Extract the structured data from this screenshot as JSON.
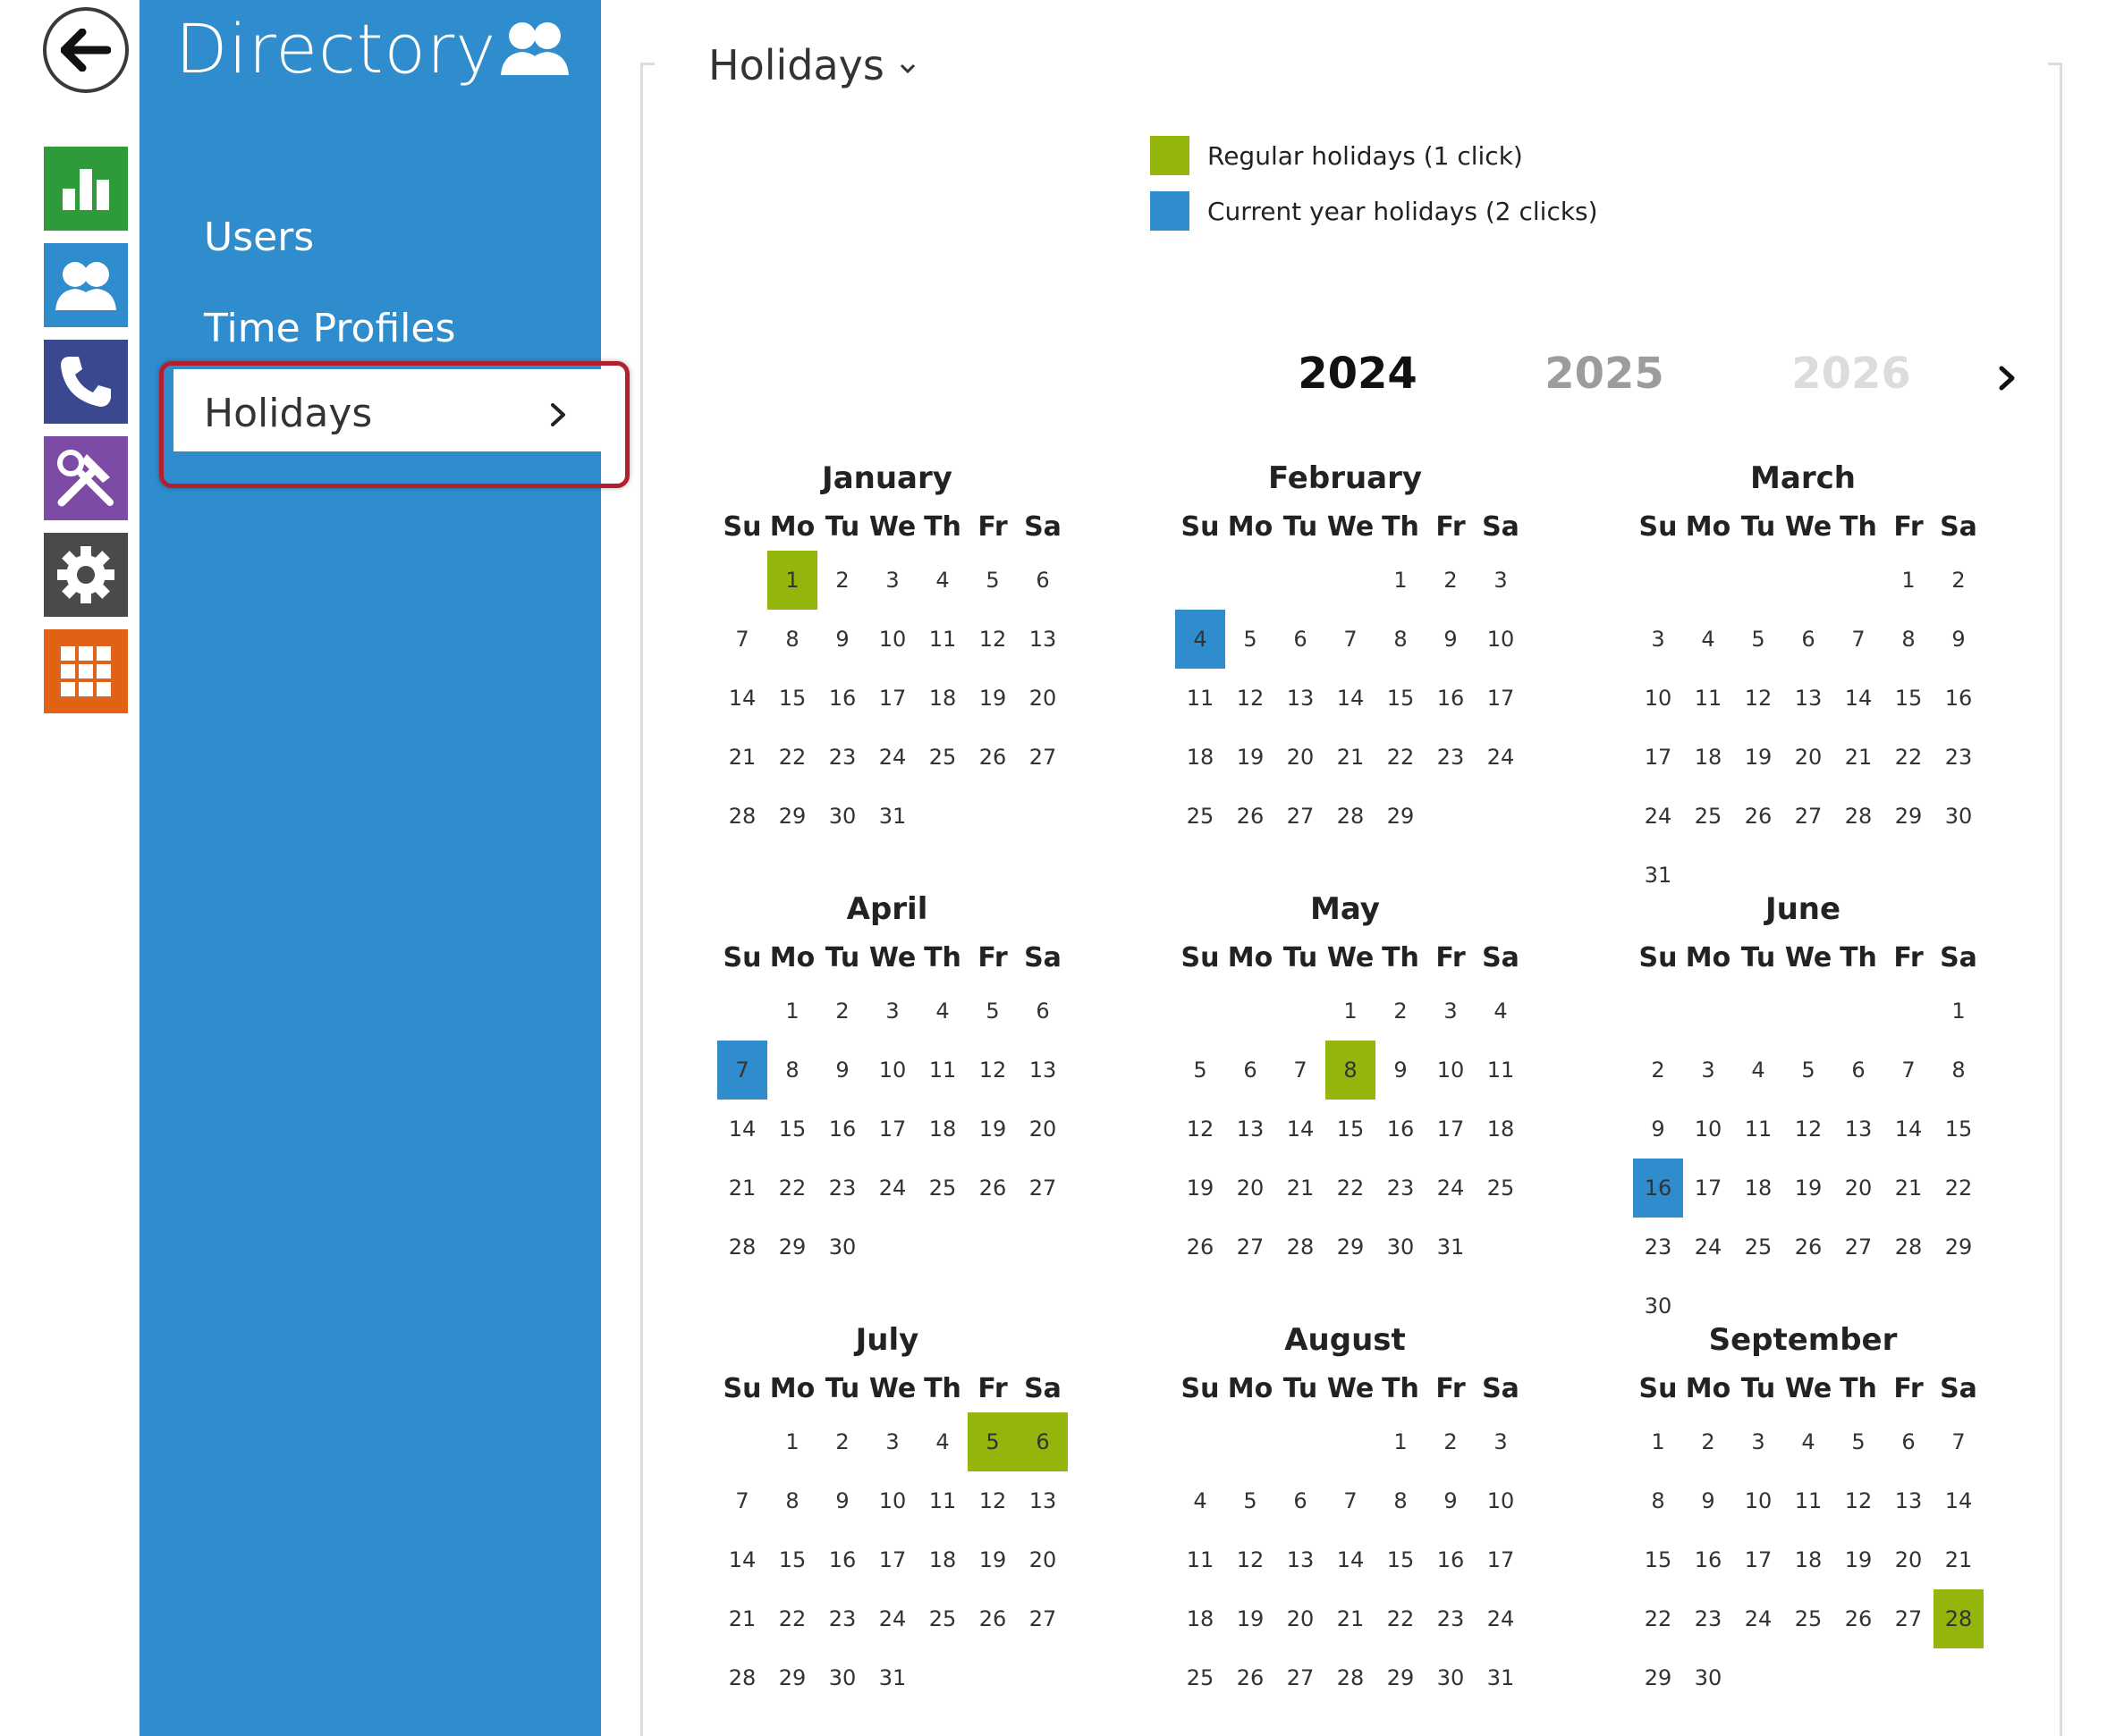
{
  "sidebar": {
    "title": "Directory",
    "items": [
      {
        "label": "Users"
      },
      {
        "label": "Time Profiles"
      },
      {
        "label": "Holidays"
      }
    ]
  },
  "rail": {
    "tiles": [
      {
        "name": "status-tile",
        "icon": "bar-chart-icon",
        "color": "#2e9a3a"
      },
      {
        "name": "directory-tile",
        "icon": "users-icon",
        "color": "#2f8ccd"
      },
      {
        "name": "calls-tile",
        "icon": "phone-icon",
        "color": "#3a4890"
      },
      {
        "name": "hardware-tile",
        "icon": "tools-icon",
        "color": "#7d4aa6"
      },
      {
        "name": "system-tile",
        "icon": "gear-icon",
        "color": "#4a4a4a"
      },
      {
        "name": "services-tile",
        "icon": "grid-icon",
        "color": "#e26215"
      }
    ]
  },
  "page": {
    "title": "Holidays"
  },
  "legend": [
    {
      "label": "Regular holidays (1 click)",
      "color": "#94b50b"
    },
    {
      "label": "Current year holidays (2 clicks)",
      "color": "#2f8ccd"
    }
  ],
  "years": [
    {
      "label": "2024",
      "color": "#111111"
    },
    {
      "label": "2025",
      "color": "#9c9c9c"
    },
    {
      "label": "2026",
      "color": "#dcdcdc"
    }
  ],
  "weekdays": [
    "Su",
    "Mo",
    "Tu",
    "We",
    "Th",
    "Fr",
    "Sa"
  ],
  "months": [
    {
      "name": "January",
      "start": 1,
      "days": 31,
      "regular": [
        1
      ],
      "current": []
    },
    {
      "name": "February",
      "start": 4,
      "days": 29,
      "regular": [],
      "current": [
        4
      ]
    },
    {
      "name": "March",
      "start": 5,
      "days": 31,
      "regular": [],
      "current": []
    },
    {
      "name": "April",
      "start": 1,
      "days": 30,
      "regular": [],
      "current": [
        7
      ]
    },
    {
      "name": "May",
      "start": 3,
      "days": 31,
      "regular": [
        8
      ],
      "current": []
    },
    {
      "name": "June",
      "start": 6,
      "days": 30,
      "regular": [],
      "current": [
        16
      ]
    },
    {
      "name": "July",
      "start": 1,
      "days": 31,
      "regular": [
        5,
        6
      ],
      "current": []
    },
    {
      "name": "August",
      "start": 4,
      "days": 31,
      "regular": [],
      "current": []
    },
    {
      "name": "September",
      "start": 0,
      "days": 30,
      "regular": [
        28
      ],
      "current": []
    }
  ]
}
